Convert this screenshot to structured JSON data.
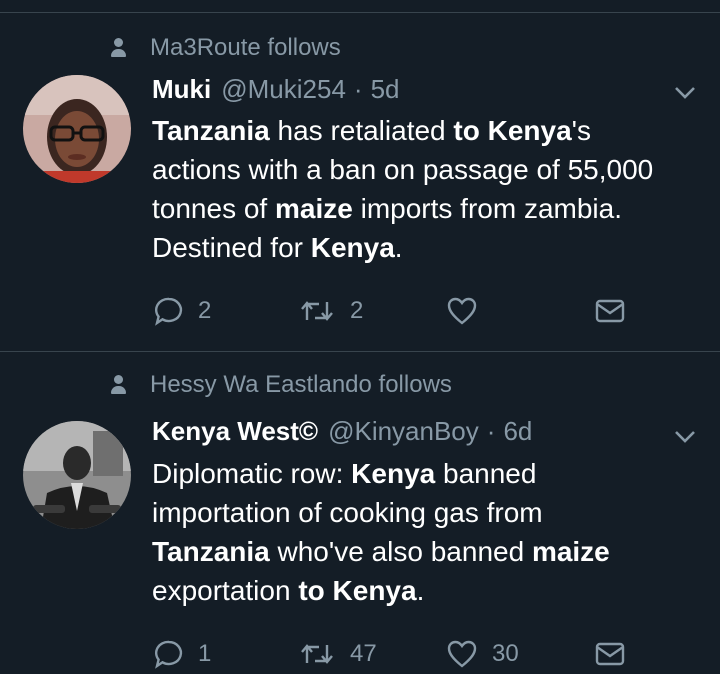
{
  "tweets": [
    {
      "social": "Ma3Route follows",
      "name": "Muki",
      "handle": "@Muki254",
      "dot": "·",
      "time": "5d",
      "body": [
        {
          "t": "Tanzania",
          "b": true
        },
        {
          "t": " has retaliated ",
          "b": false
        },
        {
          "t": "to Kenya",
          "b": true
        },
        {
          "t": "'s",
          "b": false
        },
        {
          "br": true
        },
        {
          "t": "actions with a ban on passage of 55,000",
          "b": false
        },
        {
          "br": true
        },
        {
          "t": "tonnes of ",
          "b": false
        },
        {
          "t": "maize",
          "b": true
        },
        {
          "t": " imports from zambia.",
          "b": false
        },
        {
          "br": true
        },
        {
          "t": "Destined for ",
          "b": false
        },
        {
          "t": "Kenya",
          "b": true
        },
        {
          "t": ".",
          "b": false
        }
      ],
      "replies": "2",
      "retweets": "2",
      "likes": "",
      "icons": [
        "reply-icon",
        "retweet-icon",
        "heart-icon",
        "message-icon"
      ]
    },
    {
      "social": "Hessy Wa Eastlando follows",
      "name": "Kenya West©",
      "handle": "@KinyanBoy",
      "dot": "·",
      "time": "6d",
      "body": [
        {
          "t": "Diplomatic row: ",
          "b": false
        },
        {
          "t": "Kenya",
          "b": true
        },
        {
          "t": " banned",
          "b": false
        },
        {
          "br": true
        },
        {
          "t": "importation of cooking gas from",
          "b": false
        },
        {
          "br": true
        },
        {
          "t": "Tanzania",
          "b": true
        },
        {
          "t": " who've also banned ",
          "b": false
        },
        {
          "t": "maize",
          "b": true
        },
        {
          "br": true
        },
        {
          "t": "exportation ",
          "b": false
        },
        {
          "t": "to Kenya",
          "b": true
        },
        {
          "t": ".",
          "b": false
        }
      ],
      "replies": "1",
      "retweets": "47",
      "likes": "30",
      "icons": [
        "reply-icon",
        "retweet-icon",
        "heart-icon",
        "message-icon"
      ]
    }
  ],
  "colors": {
    "background": "#141d26",
    "muted": "#8899a6",
    "divider": "#38444d",
    "text": "#ffffff"
  }
}
